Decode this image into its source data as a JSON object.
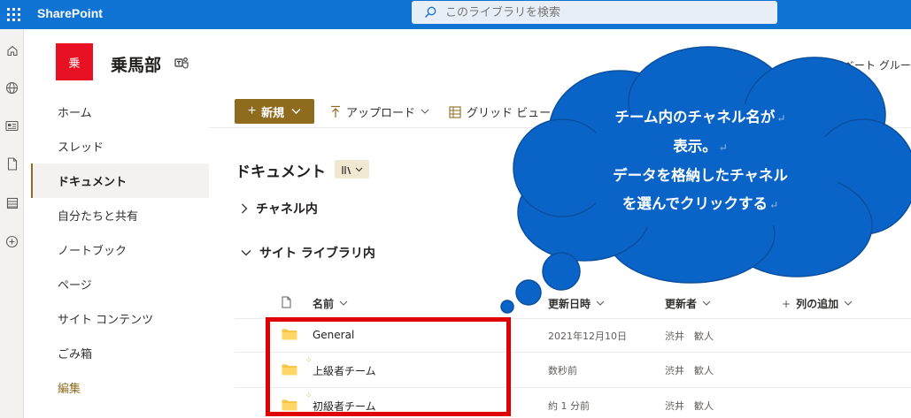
{
  "suite": {
    "brand": "SharePoint",
    "search_placeholder": "このライブラリを検索"
  },
  "site": {
    "logo_text": "乗",
    "title": "乗馬部",
    "group_label": "プライベート グルー"
  },
  "nav": {
    "items": [
      {
        "label": "ホーム"
      },
      {
        "label": "スレッド"
      },
      {
        "label": "ドキュメント"
      },
      {
        "label": "自分たちと共有"
      },
      {
        "label": "ノートブック"
      },
      {
        "label": "ページ"
      },
      {
        "label": "サイト コンテンツ"
      },
      {
        "label": "ごみ箱"
      },
      {
        "label": "編集"
      }
    ]
  },
  "commands": {
    "new": "新規",
    "upload": "アップロード",
    "grid_view": "グリッド ビュー"
  },
  "library": {
    "title": "ドキュメント",
    "groups": [
      {
        "label": "チャネル内"
      },
      {
        "label": "サイト ライブラリ内"
      }
    ],
    "columns": {
      "name": "名前",
      "modified": "更新日時",
      "modified_by": "更新者",
      "add_column": "列の追加"
    },
    "rows": [
      {
        "name": "General",
        "modified": "2021年12月10日",
        "modified_by": "渋井　歓人"
      },
      {
        "name": "上級者チーム",
        "modified": "数秒前",
        "modified_by": "渋井　歓人"
      },
      {
        "name": "初級者チーム",
        "modified": "約 1 分前",
        "modified_by": "渋井　歓人"
      }
    ]
  },
  "callout": {
    "lines": [
      "チーム内のチャネル名が",
      "表示。",
      "データを格納したチャネル",
      "を選んでクリックする"
    ],
    "color": "#0a64c8"
  },
  "colors": {
    "suite_bar": "#1074d4",
    "accent": "#8f6b1e",
    "highlight": "#e00000"
  }
}
